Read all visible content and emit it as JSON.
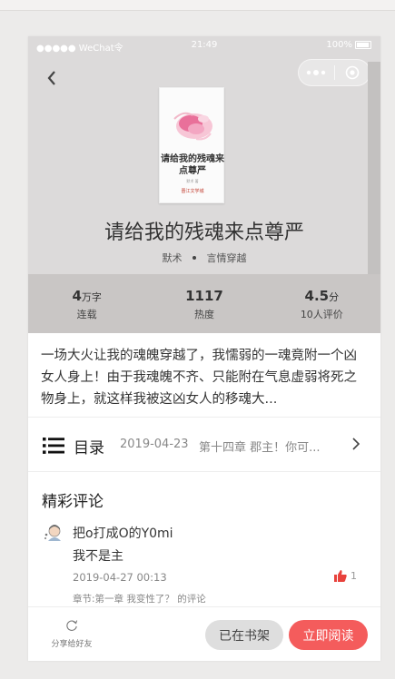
{
  "status_bar": {
    "carrier": "●●●●● WeChat令",
    "time": "21:49",
    "battery": "100%"
  },
  "book": {
    "cover_title": "请给我的残魂来点尊严",
    "cover_author": "默术 著",
    "cover_publisher": "晋江文学城",
    "title": "请给我的残魂来点尊严",
    "author": "默术",
    "genre": "言情穿越"
  },
  "stats": [
    {
      "value": "4",
      "unit": "万字",
      "label": "连载"
    },
    {
      "value": "1117",
      "unit": "",
      "label": "热度"
    },
    {
      "value": "4.5",
      "unit": "分",
      "label": "10人评价"
    }
  ],
  "intro": "一场大火让我的魂魄穿越了，我懦弱的一魂竟附一个凶女人身上！由于我魂魄不齐、只能附在气息虚弱将死之物身上，就这样我被这凶女人的移魂大...",
  "toc": {
    "label": "目录",
    "date": "2019-04-23",
    "latest_chapter": "第十四章 郡主！你可..."
  },
  "comments": {
    "title": "精彩评论",
    "items": [
      {
        "user": "把o打成O的Y0mi",
        "text": "我不是主",
        "time": "2019-04-27 00:13",
        "likes": "1",
        "chapter": "章节:第一章 我变性了？ 的评论"
      }
    ]
  },
  "bottom": {
    "share_label": "分享给好友",
    "shelf_label": "已在书架",
    "read_label": "立即阅读"
  },
  "colors": {
    "accent": "#f45c5c",
    "like": "#e8423c",
    "hero_bg": "#dcdada",
    "stats_bg": "#c9c6c5"
  }
}
